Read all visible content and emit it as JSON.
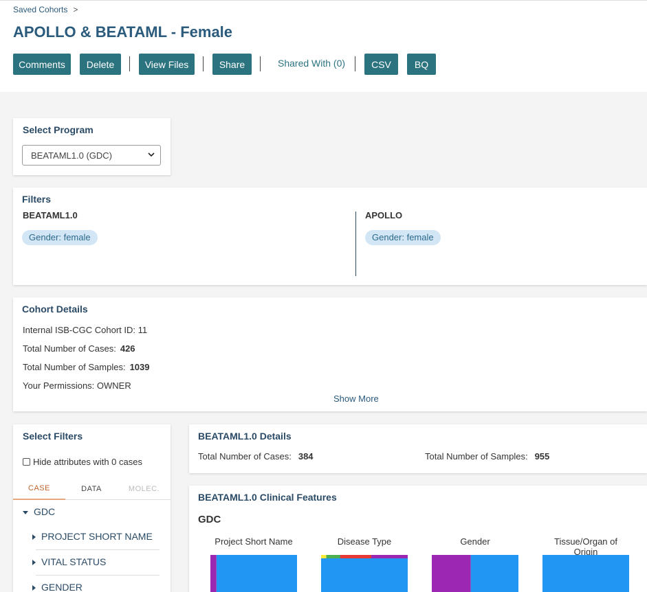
{
  "breadcrumb": {
    "link": "Saved Cohorts",
    "separator": ">"
  },
  "page_title": "APOLLO & BEATAML - Female",
  "toolbar": {
    "comments": "Comments",
    "delete": "Delete",
    "view_files": "View Files",
    "share": "Share",
    "shared_with": "Shared With (0)",
    "csv": "CSV",
    "bq": "BQ"
  },
  "select_program": {
    "title": "Select Program",
    "selected": "BEATAML1.0 (GDC)"
  },
  "filters": {
    "title": "Filters",
    "programs": [
      {
        "name": "BEATAML1.0",
        "pill": "Gender: female"
      },
      {
        "name": "APOLLO",
        "pill": "Gender: female"
      }
    ]
  },
  "cohort_details": {
    "title": "Cohort Details",
    "id_line": "Internal ISB-CGC Cohort ID: 11",
    "cases_label": "Total Number of Cases:",
    "cases_value": "426",
    "samples_label": "Total Number of Samples:",
    "samples_value": "1039",
    "permissions": "Your Permissions: OWNER",
    "show_more": "Show More"
  },
  "select_filters": {
    "title": "Select Filters",
    "hide_zero": "Hide attributes with 0 cases",
    "tabs": [
      "CASE",
      "DATA",
      "MOLEC."
    ],
    "group": "GDC",
    "items": [
      "PROJECT SHORT NAME",
      "VITAL STATUS",
      "GENDER"
    ]
  },
  "program_details": {
    "title": "BEATAML1.0 Details",
    "cases_label": "Total Number of Cases:",
    "cases_value": "384",
    "samples_label": "Total Number of Samples:",
    "samples_value": "955"
  },
  "clinical": {
    "title": "BEATAML1.0 Clinical Features",
    "source": "GDC",
    "chart_titles": [
      "Project Short Name",
      "Disease Type",
      "Gender",
      "Tissue/Organ of Origin"
    ]
  },
  "colors": {
    "accent": "#2c7380",
    "heading": "#2a4a66",
    "pill_bg": "#d3e6f6",
    "bar_blue": "#2196f3",
    "bar_purple": "#9c27b0",
    "bar_red": "#e53935",
    "bar_green": "#4caf50",
    "bar_yellow": "#ffeb3b"
  },
  "chart_data": [
    {
      "type": "bar",
      "title": "Project Short Name",
      "segments": [
        {
          "color": "#9c27b0",
          "value": 0.07
        },
        {
          "color": "#2196f3",
          "value": 0.93
        }
      ]
    },
    {
      "type": "bar",
      "title": "Disease Type",
      "top_strip": [
        {
          "color": "#ffeb3b",
          "value": 0.06
        },
        {
          "color": "#4caf50",
          "value": 0.16
        },
        {
          "color": "#e53935",
          "value": 0.36
        },
        {
          "color": "#9c27b0",
          "value": 0.42
        }
      ],
      "fill": "#2196f3"
    },
    {
      "type": "bar",
      "title": "Gender",
      "segments": [
        {
          "color": "#9c27b0",
          "value": 0.45
        },
        {
          "color": "#2196f3",
          "value": 0.55
        }
      ]
    },
    {
      "type": "bar",
      "title": "Tissue/Organ of Origin",
      "segments": [
        {
          "color": "#2196f3",
          "value": 1.0
        }
      ]
    }
  ]
}
